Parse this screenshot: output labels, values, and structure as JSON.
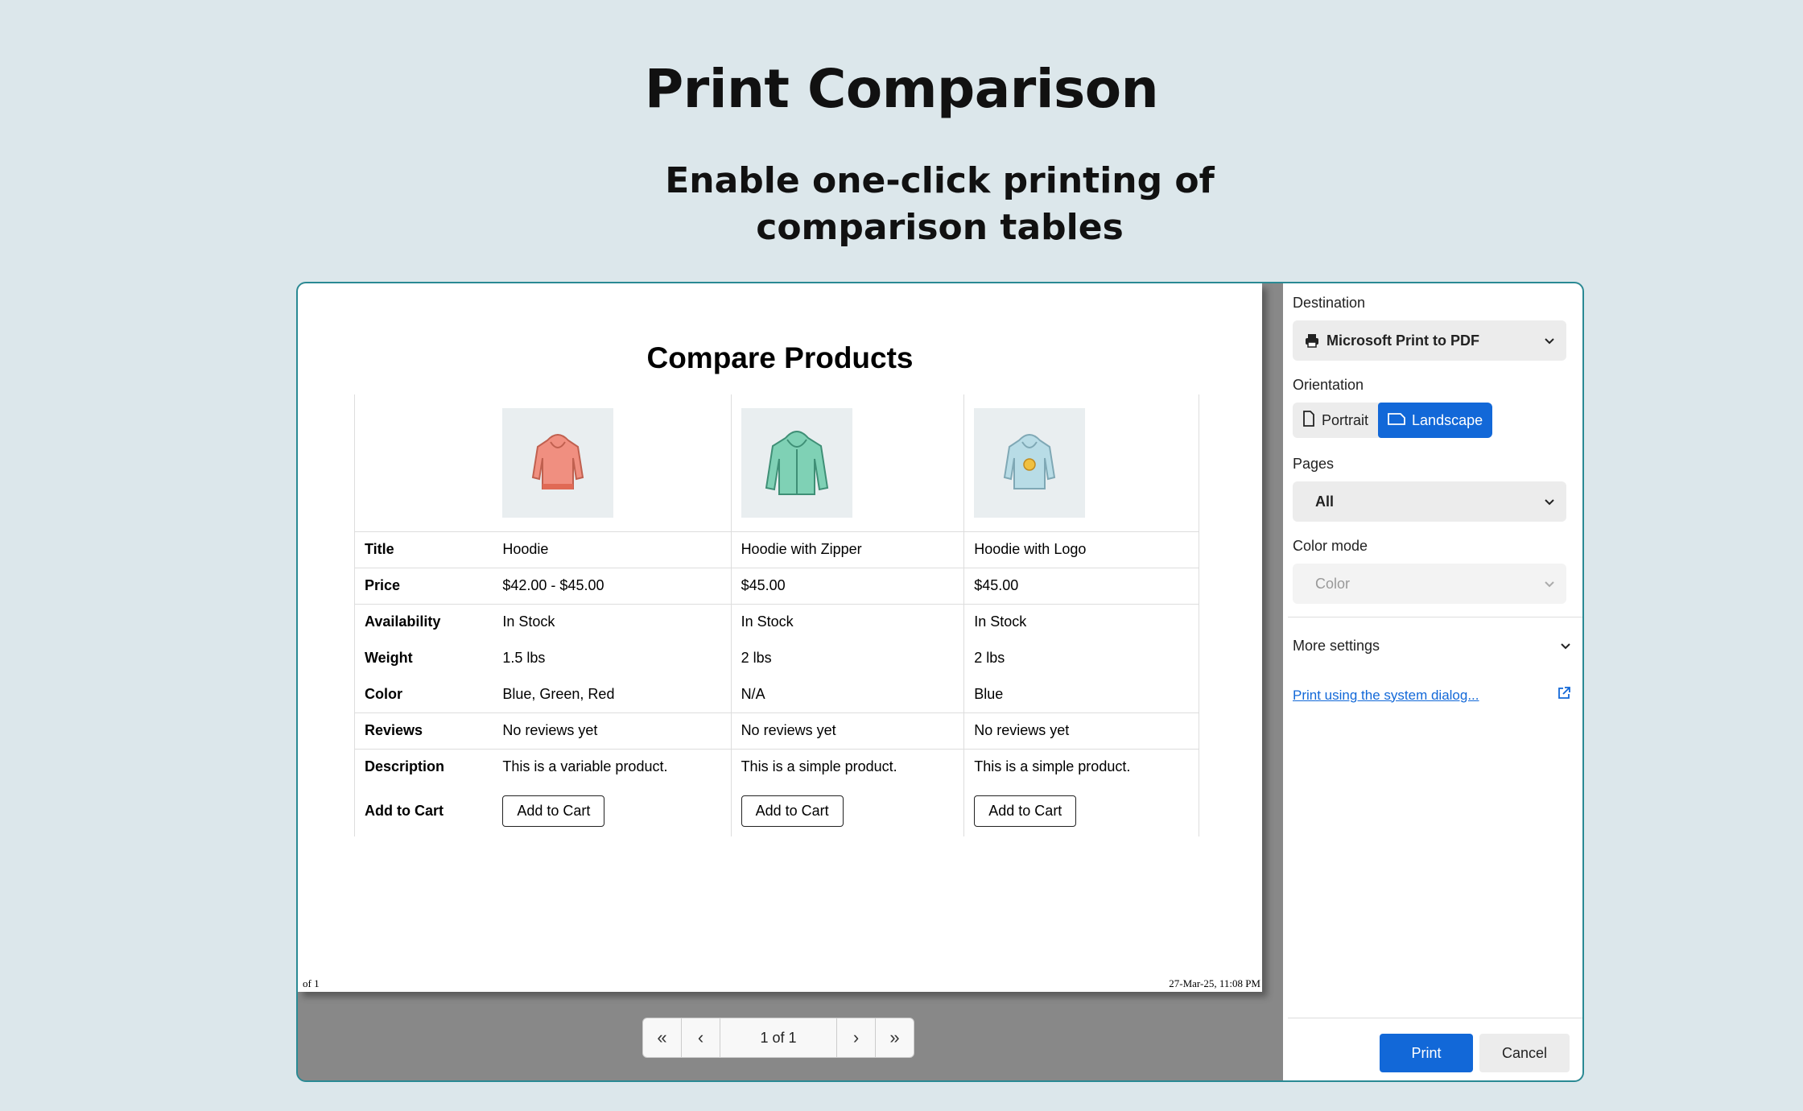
{
  "hero": {
    "title": "Print Comparison",
    "subtitle": "Enable one-click printing of comparison tables"
  },
  "page": {
    "title": "Compare Products",
    "footer_left": "of 1",
    "footer_right": "27-Mar-25, 11:08 PM",
    "products": [
      {
        "image": "pink-hoodie",
        "color": "#f08f80"
      },
      {
        "image": "green-zip-hoodie",
        "color": "#7fd1b5"
      },
      {
        "image": "blue-logo-hoodie",
        "color": "#b8dce6"
      }
    ],
    "rows": [
      {
        "label": "Title",
        "values": [
          "Hoodie",
          "Hoodie with Zipper",
          "Hoodie with Logo"
        ]
      },
      {
        "label": "Price",
        "values": [
          "$42.00 - $45.00",
          "$45.00",
          "$45.00"
        ]
      },
      {
        "label": "Availability",
        "values": [
          "In Stock",
          "In Stock",
          "In Stock"
        ]
      },
      {
        "label": "Weight",
        "values": [
          "1.5 lbs",
          "2 lbs",
          "2 lbs"
        ]
      },
      {
        "label": "Color",
        "values": [
          "Blue, Green, Red",
          "N/A",
          "Blue"
        ]
      },
      {
        "label": "Reviews",
        "values": [
          "No reviews yet",
          "No reviews yet",
          "No reviews yet"
        ]
      },
      {
        "label": "Description",
        "values": [
          "This is a variable product.",
          "This is a simple product.",
          "This is a simple product."
        ]
      },
      {
        "label": "Add to Cart",
        "values": [
          "Add to Cart",
          "Add to Cart",
          "Add to Cart"
        ]
      }
    ]
  },
  "pager": {
    "info": "1 of 1",
    "first_icon": "double-chevron-left-icon",
    "prev_icon": "chevron-left-icon",
    "next_icon": "chevron-right-icon",
    "last_icon": "double-chevron-right-icon"
  },
  "settings": {
    "destination_label": "Destination",
    "destination_value": "Microsoft Print to PDF",
    "orientation_label": "Orientation",
    "portrait": "Portrait",
    "landscape": "Landscape",
    "orientation_selected": "Landscape",
    "pages_label": "Pages",
    "pages_value": "All",
    "color_mode_label": "Color mode",
    "color_mode_value": "Color",
    "more_settings": "More settings",
    "system_dialog_link": "Print using the system dialog...",
    "print_button": "Print",
    "cancel_button": "Cancel"
  },
  "colors": {
    "accent": "#1268d8",
    "frame_border": "#2a8a94",
    "background": "#dce7eb"
  }
}
